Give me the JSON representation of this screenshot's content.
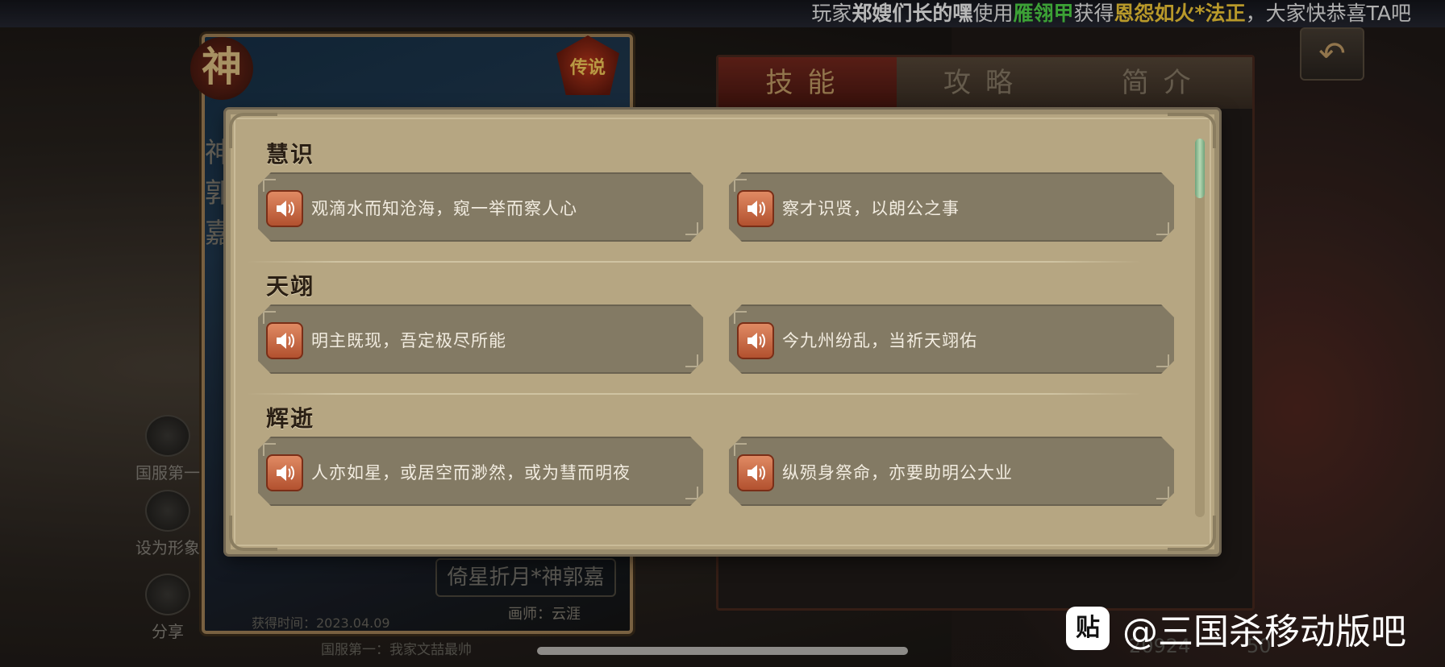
{
  "ticker": {
    "prefix": "玩家",
    "player": "郑嫂们长的嘿",
    "mid1": "使用",
    "item": "雁翎甲",
    "mid2": "获得",
    "skin": "恩怨如火*法正",
    "suffix": "，大家快恭喜TA吧"
  },
  "card": {
    "seal": "神",
    "badge": "传说",
    "vertical_name": "神郭嘉",
    "title": "倚星折月*神郭嘉",
    "artist": "画师：云涯",
    "obtained": "获得时间：2023.04.09",
    "rank": "国服第一：我家文喆最帅"
  },
  "side_buttons": [
    {
      "label": "国服第一",
      "icon": "rank-icon"
    },
    {
      "label": "设为形象",
      "icon": "avatar-icon"
    },
    {
      "label": "分享",
      "icon": "share-icon"
    }
  ],
  "tabs": [
    {
      "label": "技能",
      "active": true
    },
    {
      "label": "攻略",
      "active": false
    },
    {
      "label": "简介",
      "active": false
    }
  ],
  "back_button": {
    "icon": "back-arrow-icon"
  },
  "stats": {
    "coins": "20924",
    "gems": "50"
  },
  "watermark": {
    "logo": "贴",
    "text": "@三国杀移动版吧"
  },
  "dialog": {
    "sections": [
      {
        "title": "慧识",
        "lines": [
          "观滴水而知沧海，窥一举而察人心",
          "察才识贤，以朗公之事"
        ]
      },
      {
        "title": "天翊",
        "lines": [
          "明主既现，吾定极尽所能",
          "今九州纷乱，当祈天翊佑"
        ]
      },
      {
        "title": "辉逝",
        "lines": [
          "人亦如星，或居空而渺然，或为彗而明夜",
          "纵殒身祭命，亦要助明公大业"
        ]
      }
    ]
  },
  "colors": {
    "dialog_bg": "#b6a682",
    "line_bg": "#837a64",
    "speaker": "#c8653f",
    "scroll_thumb": "#8fc09a",
    "active_tab": "#7a2a1f"
  }
}
